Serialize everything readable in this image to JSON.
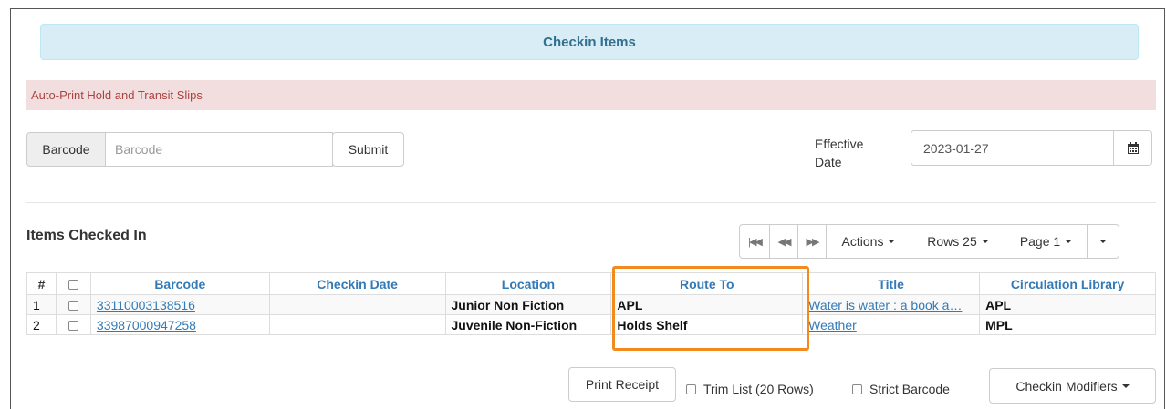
{
  "header": {
    "title": "Checkin Items"
  },
  "alert": {
    "text": "Auto-Print Hold and Transit Slips"
  },
  "form": {
    "barcode_label": "Barcode",
    "barcode_placeholder": "Barcode",
    "submit_label": "Submit",
    "effective_date_label_line1": "Effective",
    "effective_date_label_line2": "Date",
    "effective_date_value": "2023-01-27",
    "calendar_icon": "calendar-icon"
  },
  "section": {
    "title": "Items Checked In"
  },
  "pager": {
    "first_icon": "first-page-icon",
    "prev_icon": "previous-page-icon",
    "next_icon": "next-page-icon",
    "actions_label": "Actions",
    "rows_label": "Rows 25",
    "page_label": "Page 1"
  },
  "table": {
    "columns": [
      "#",
      "",
      "Barcode",
      "Checkin Date",
      "Location",
      "Route To",
      "Title",
      "Circulation Library"
    ],
    "rows": [
      {
        "num": "1",
        "barcode": "33110003138516",
        "checkin_date": "",
        "location": "Junior Non Fiction",
        "route_to": "APL",
        "title": "Water is water : a book a…",
        "library": "APL"
      },
      {
        "num": "2",
        "barcode": "33987000947258",
        "checkin_date": "",
        "location": "Juvenile Non-Fiction",
        "route_to": "Holds Shelf",
        "title": "Weather",
        "library": "MPL"
      }
    ]
  },
  "footer": {
    "print_receipt_label": "Print Receipt",
    "trim_list_label": "Trim List (20 Rows)",
    "strict_barcode_label": "Strict Barcode",
    "checkin_modifiers_label": "Checkin Modifiers"
  },
  "colors": {
    "highlight": "#f28a1e",
    "link": "#337ab7",
    "banner_bg": "#d9edf7",
    "alert_bg": "#f2dede"
  }
}
